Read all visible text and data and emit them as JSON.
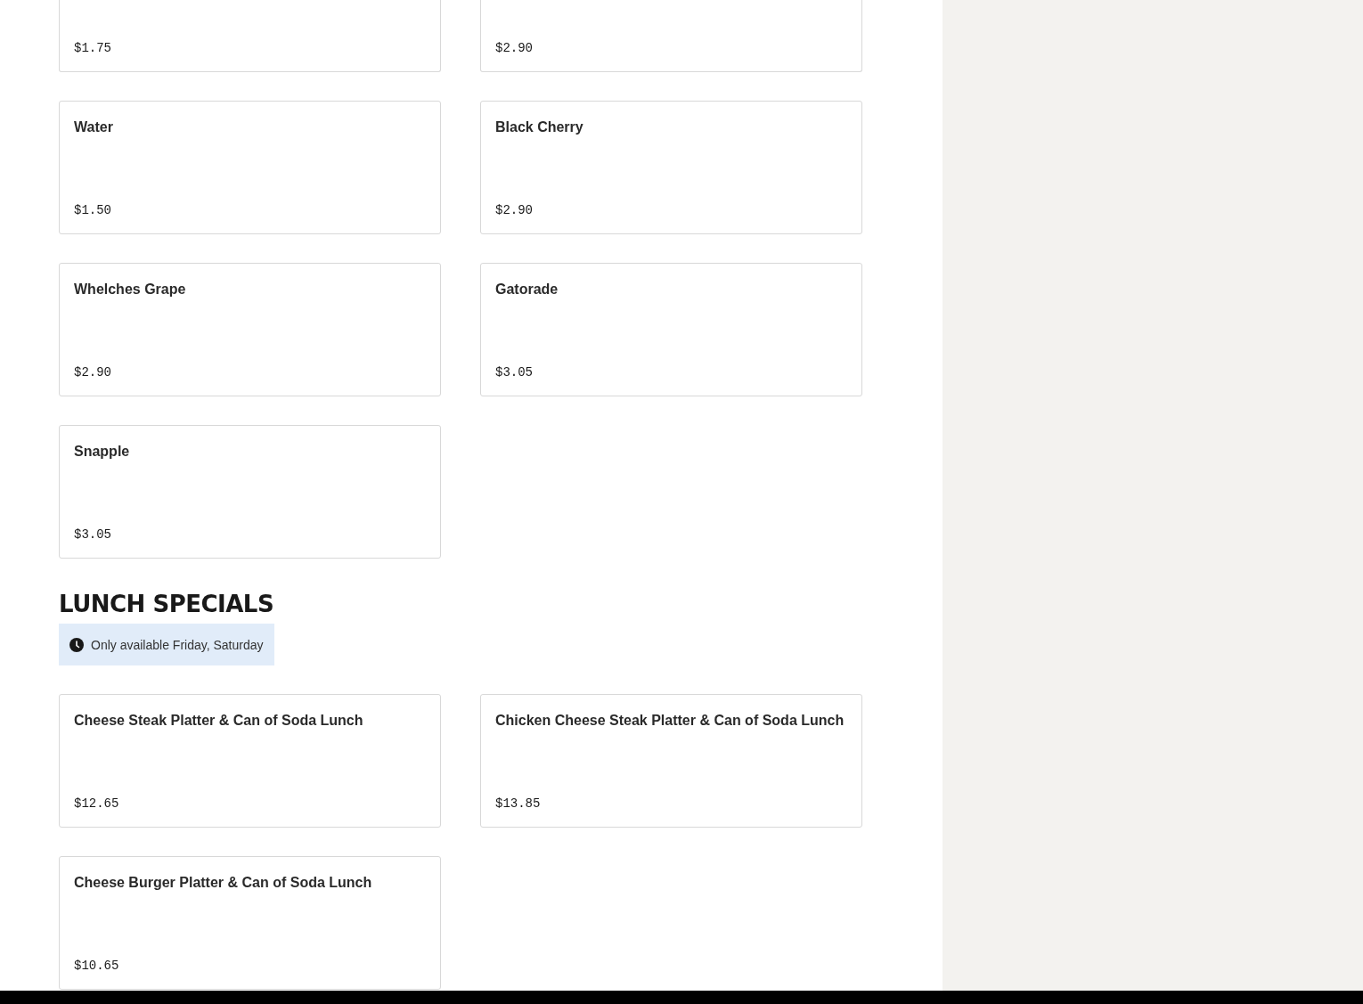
{
  "sections": [
    {
      "items": [
        {
          "price": "$1.75",
          "cut": true
        },
        {
          "price": "$2.90",
          "cut": true
        },
        {
          "name": "Water",
          "price": "$1.50",
          "cut": false
        },
        {
          "name": "Black Cherry",
          "price": "$2.90",
          "cut": false
        },
        {
          "name": "Whelches Grape",
          "price": "$2.90",
          "cut": false
        },
        {
          "name": "Gatorade",
          "price": "$3.05",
          "cut": false
        },
        {
          "name": "Snapple",
          "price": "$3.05",
          "cut": false
        }
      ]
    },
    {
      "title": "LUNCH SPECIALS",
      "availability": "Only available Friday, Saturday",
      "items": [
        {
          "name": "Cheese Steak Platter & Can of Soda Lunch",
          "price": "$12.65",
          "cut": false
        },
        {
          "name": "Chicken Cheese Steak Platter & Can of Soda Lunch",
          "price": "$13.85",
          "cut": false
        },
        {
          "name": "Cheese Burger Platter & Can of Soda Lunch",
          "price": "$10.65",
          "cut": false
        }
      ]
    }
  ]
}
